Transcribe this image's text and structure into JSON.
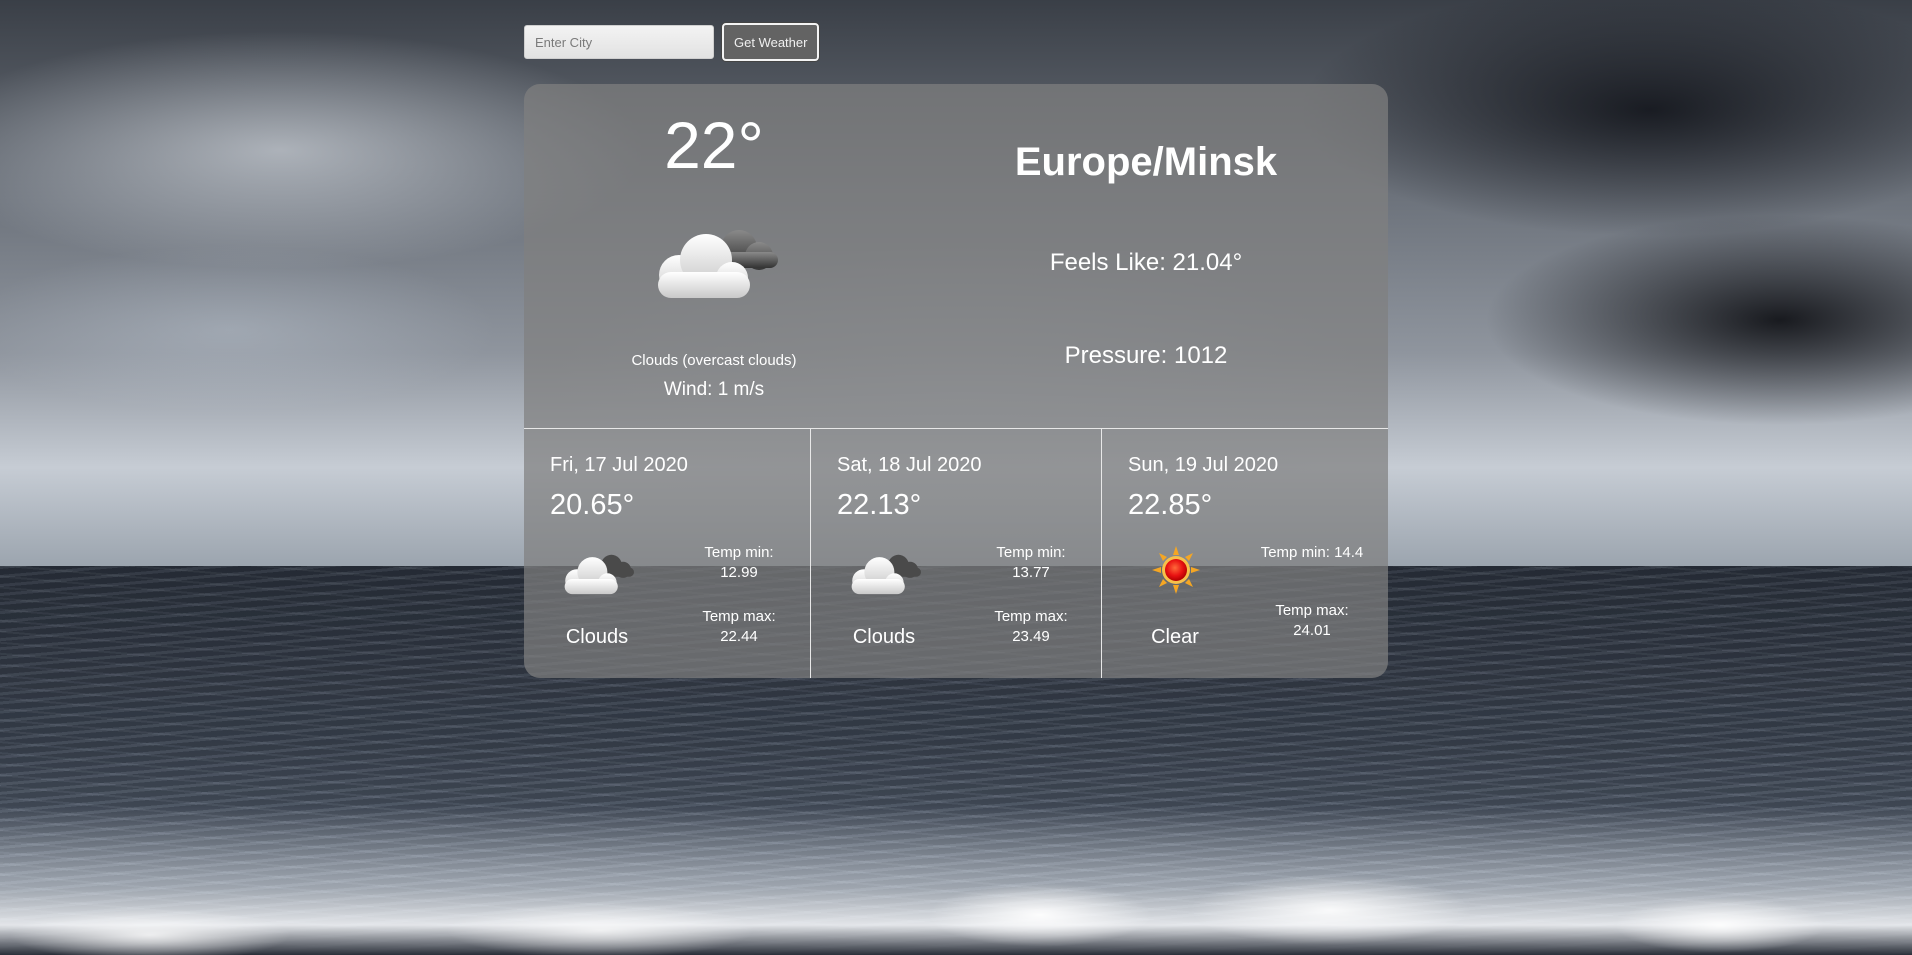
{
  "search": {
    "placeholder": "Enter City",
    "button_label": "Get Weather"
  },
  "current": {
    "temp": "22°",
    "city": "Europe/Minsk",
    "icon": "cloud-icon",
    "description": "Clouds (overcast clouds)",
    "wind": "Wind: 1 m/s",
    "feels_like": "Feels Like: 21.04°",
    "pressure": "Pressure: 1012"
  },
  "forecast": [
    {
      "date": "Fri, 17 Jul 2020",
      "temp": "20.65°",
      "icon": "cloud-icon",
      "condition": "Clouds",
      "min_label": "Temp min:",
      "min": "12.99",
      "max_label": "Temp max:",
      "max": "22.44"
    },
    {
      "date": "Sat, 18 Jul 2020",
      "temp": "22.13°",
      "icon": "cloud-icon",
      "condition": "Clouds",
      "min_label": "Temp min:",
      "min": "13.77",
      "max_label": "Temp max:",
      "max": "23.49"
    },
    {
      "date": "Sun, 19 Jul 2020",
      "temp": "22.85°",
      "icon": "sun-icon",
      "condition": "Clear",
      "min_label": "Temp min: 14.4",
      "min": "",
      "max_label": "Temp max:",
      "max": "24.01"
    }
  ]
}
